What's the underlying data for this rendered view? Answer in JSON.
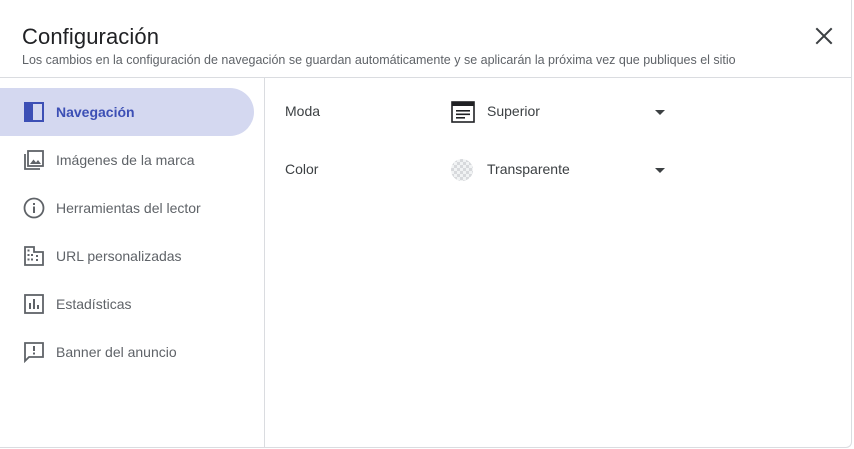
{
  "dialog": {
    "title": "Configuración",
    "subtitle": "Los cambios en la configuración de navegación se guardan automáticamente y se aplicarán la próxima vez que publiques el sitio",
    "close_icon": "close-icon"
  },
  "sidebar": {
    "items": [
      {
        "label": "Navegación",
        "icon": "navigation-layout-icon",
        "active": true
      },
      {
        "label": "Imágenes de la marca",
        "icon": "image-library-icon",
        "active": false
      },
      {
        "label": "Herramientas del lector",
        "icon": "info-icon",
        "active": false
      },
      {
        "label": "URL personalizadas",
        "icon": "building-icon",
        "active": false
      },
      {
        "label": "Estadísticas",
        "icon": "bar-chart-icon",
        "active": false
      },
      {
        "label": "Banner del anuncio",
        "icon": "announcement-icon",
        "active": false
      }
    ]
  },
  "settings": {
    "mode": {
      "label": "Moda",
      "value": "Superior",
      "icon": "top-nav-icon"
    },
    "color": {
      "label": "Color",
      "value": "Transparente",
      "icon": "transparent-swatch-icon"
    }
  },
  "colors": {
    "accent": "#3c4fb5",
    "active_bg": "#d4d8f0",
    "divider": "#dadce0",
    "muted_text": "#5f6368"
  }
}
